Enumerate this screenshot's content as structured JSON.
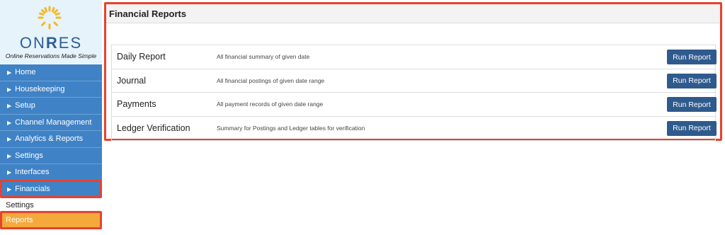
{
  "brand": {
    "left": "ON",
    "mid": "R",
    "right": "ES",
    "tagline": "Online Reservations Made Simple"
  },
  "nav": [
    "Home",
    "Housekeeping",
    "Setup",
    "Channel Management",
    "Analytics & Reports",
    "Settings",
    "Interfaces",
    "Financials"
  ],
  "subnav": [
    "Settings",
    "Reports"
  ],
  "panel": {
    "title": "Financial Reports"
  },
  "reports": [
    {
      "name": "Daily Report",
      "desc": "All financial summary of given date",
      "button": "Run Report"
    },
    {
      "name": "Journal",
      "desc": "All financial postings of given date range",
      "button": "Run Report"
    },
    {
      "name": "Payments",
      "desc": "All payment records of given date range",
      "button": "Run Report"
    },
    {
      "name": "Ledger Verification",
      "desc": "Summary for Postings and Ledger tables for verification",
      "button": "Run Report"
    }
  ],
  "colors": {
    "nav": "#3f82c6",
    "active": "#f4a93b",
    "highlight": "#e8422d",
    "button": "#2f5a8d"
  }
}
